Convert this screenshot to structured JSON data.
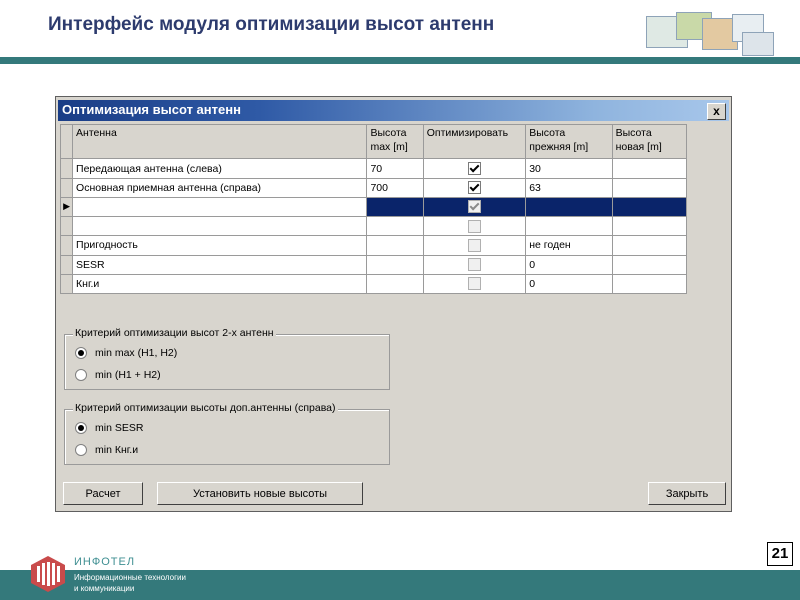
{
  "slide": {
    "title": "Интерфейс модуля оптимизации высот антенн",
    "page_number": "21"
  },
  "window": {
    "title": "Оптимизация высот антенн",
    "close_label": "x"
  },
  "grid": {
    "headers": {
      "antenna": "Антенна",
      "height_max": "Высота max [m]",
      "optimize": "Оптимизировать",
      "height_prev": "Высота прежняя [m]",
      "height_new": "Высота новая [m]"
    },
    "rows": [
      {
        "name": "Передающая антенна (слева)",
        "hmax": "70",
        "optimize": true,
        "prev": "30",
        "new": ""
      },
      {
        "name": "Основная приемная антенна (справа)",
        "hmax": "700",
        "optimize": true,
        "prev": "63",
        "new": ""
      },
      {
        "name": "",
        "hmax": "",
        "optimize": true,
        "prev": "",
        "new": ""
      },
      {
        "name": "",
        "hmax": "",
        "optimize": false,
        "prev": "",
        "new": ""
      },
      {
        "name": "Пригодность",
        "hmax": "",
        "optimize": false,
        "prev": "не годен",
        "new": ""
      },
      {
        "name": "SESR",
        "hmax": "",
        "optimize": false,
        "prev": "0",
        "new": ""
      },
      {
        "name": "Кнг.и",
        "hmax": "",
        "optimize": false,
        "prev": "0",
        "new": ""
      }
    ]
  },
  "criteria_two": {
    "legend": "Критерий оптимизации высот 2-х антенн",
    "options": [
      "min max (H1, H2)",
      "min (H1 + H2)"
    ],
    "selected": 0
  },
  "criteria_extra": {
    "legend": "Критерий оптимизации высоты доп.антенны (справа)",
    "options": [
      "min SESR",
      "min Кнг.и"
    ],
    "selected": 0
  },
  "buttons": {
    "calc": "Расчет",
    "set_heights": "Установить новые высоты",
    "close": "Закрыть"
  },
  "footer": {
    "company": "ИНФОТЕЛ",
    "subtitle_line1": "Информационные технологии",
    "subtitle_line2": "и коммуникации"
  },
  "colors": {
    "accent_teal": "#34797b",
    "title_blue": "#2d3b6e",
    "selection": "#0a246a"
  }
}
